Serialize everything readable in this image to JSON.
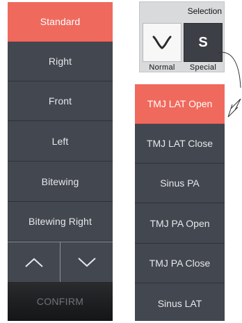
{
  "left_menu": {
    "items": [
      {
        "label": "Standard",
        "active": true
      },
      {
        "label": "Right",
        "active": false
      },
      {
        "label": "Front",
        "active": false
      },
      {
        "label": "Left",
        "active": false
      },
      {
        "label": "Bitewing",
        "active": false
      },
      {
        "label": "Bitewing Right",
        "active": false
      }
    ],
    "up_icon": "chevron-up-icon",
    "down_icon": "chevron-down-icon",
    "confirm_label": "CONFIRM"
  },
  "selection": {
    "title": "Selection",
    "normal": {
      "label": "Normal",
      "icon": "v-shape-icon"
    },
    "special": {
      "label": "Special",
      "glyph": "S",
      "selected": true
    }
  },
  "special_menu": {
    "items": [
      {
        "label": "TMJ LAT Open",
        "active": true
      },
      {
        "label": "TMJ LAT Close",
        "active": false
      },
      {
        "label": "Sinus PA",
        "active": false
      },
      {
        "label": "TMJ PA Open",
        "active": false
      },
      {
        "label": "TMJ PA Close",
        "active": false
      },
      {
        "label": "Sinus LAT",
        "active": false
      }
    ]
  },
  "colors": {
    "panel": "#43474f",
    "active": "#ef6a5d",
    "text": "#e6e8eb",
    "confirm_text": "#707378"
  }
}
